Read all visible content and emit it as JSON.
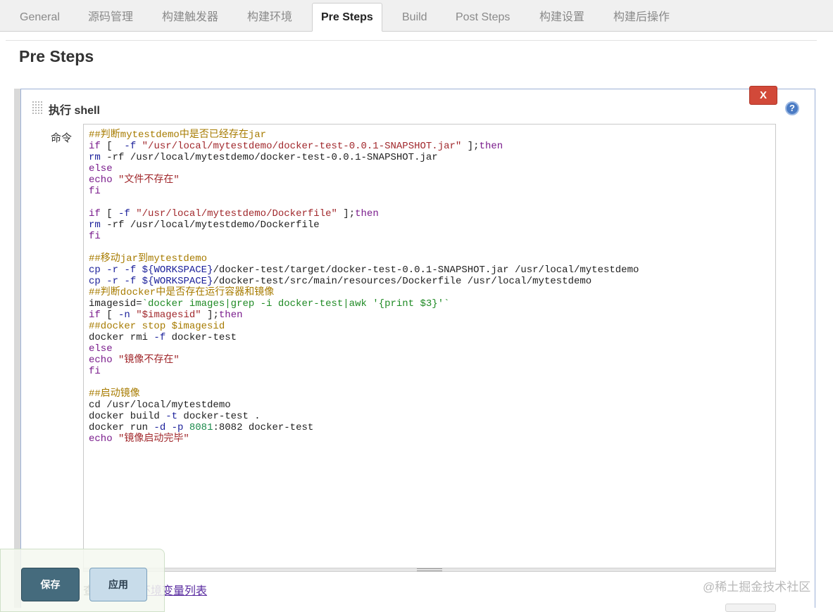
{
  "tabs": [
    {
      "label": "General"
    },
    {
      "label": "源码管理"
    },
    {
      "label": "构建触发器"
    },
    {
      "label": "构建环境"
    },
    {
      "label": "Pre Steps"
    },
    {
      "label": "Build"
    },
    {
      "label": "Post Steps"
    },
    {
      "label": "构建设置"
    },
    {
      "label": "构建后操作"
    }
  ],
  "active_tab": "Pre Steps",
  "page_title": "Pre Steps",
  "step": {
    "title": "执行 shell",
    "delete_label": "X",
    "help_label": "?",
    "command_label": "命令",
    "command_lines": [
      "##判断mytestdemo中是否已经存在jar",
      "if [  -f \"/usr/local/mytestdemo/docker-test-0.0.1-SNAPSHOT.jar\" ];then",
      "rm -rf /usr/local/mytestdemo/docker-test-0.0.1-SNAPSHOT.jar",
      "else",
      "echo \"文件不存在\"",
      "fi",
      "",
      "if [ -f \"/usr/local/mytestdemo/Dockerfile\" ];then",
      "rm -rf /usr/local/mytestdemo/Dockerfile",
      "fi",
      "",
      "##移动jar到mytestdemo",
      "cp -r -f ${WORKSPACE}/docker-test/target/docker-test-0.0.1-SNAPSHOT.jar /usr/local/mytestdemo",
      "cp -r -f ${WORKSPACE}/docker-test/src/main/resources/Dockerfile /usr/local/mytestdemo",
      "##判断docker中是否存在运行容器和镜像",
      "imagesid=`docker images|grep -i docker-test|awk '{print $3}'`",
      "if [ -n \"$imagesid\" ];then",
      "##docker stop $imagesid",
      "docker rmi -f docker-test",
      "else",
      "echo \"镜像不存在\"",
      "fi",
      "",
      "##启动镜像",
      "cd /usr/local/mytestdemo",
      "docker build -t docker-test .",
      "docker run -d -p 8081:8082 docker-test",
      "echo \"镜像启动完毕\""
    ],
    "env_link_prefix": "查看",
    "env_link_text": "可用的环境变量列表"
  },
  "buttons": {
    "save": "保存",
    "apply": "应用"
  },
  "watermark": "@稀土掘金技术社区",
  "colors": {
    "active_tab_bg": "#ffffff",
    "delete_button": "#d24939",
    "help_icon": "#4a7bc4",
    "save_button": "#456b7d",
    "apply_button": "#c8dcea",
    "panel_border": "#9db1d6",
    "comment": "#a77b00",
    "keyword": "#7a1c8c",
    "string": "#a1282c",
    "variable": "#1a1f9a"
  },
  "icons": {
    "drag_handle": "drag-handle-icon",
    "help": "help-icon"
  }
}
